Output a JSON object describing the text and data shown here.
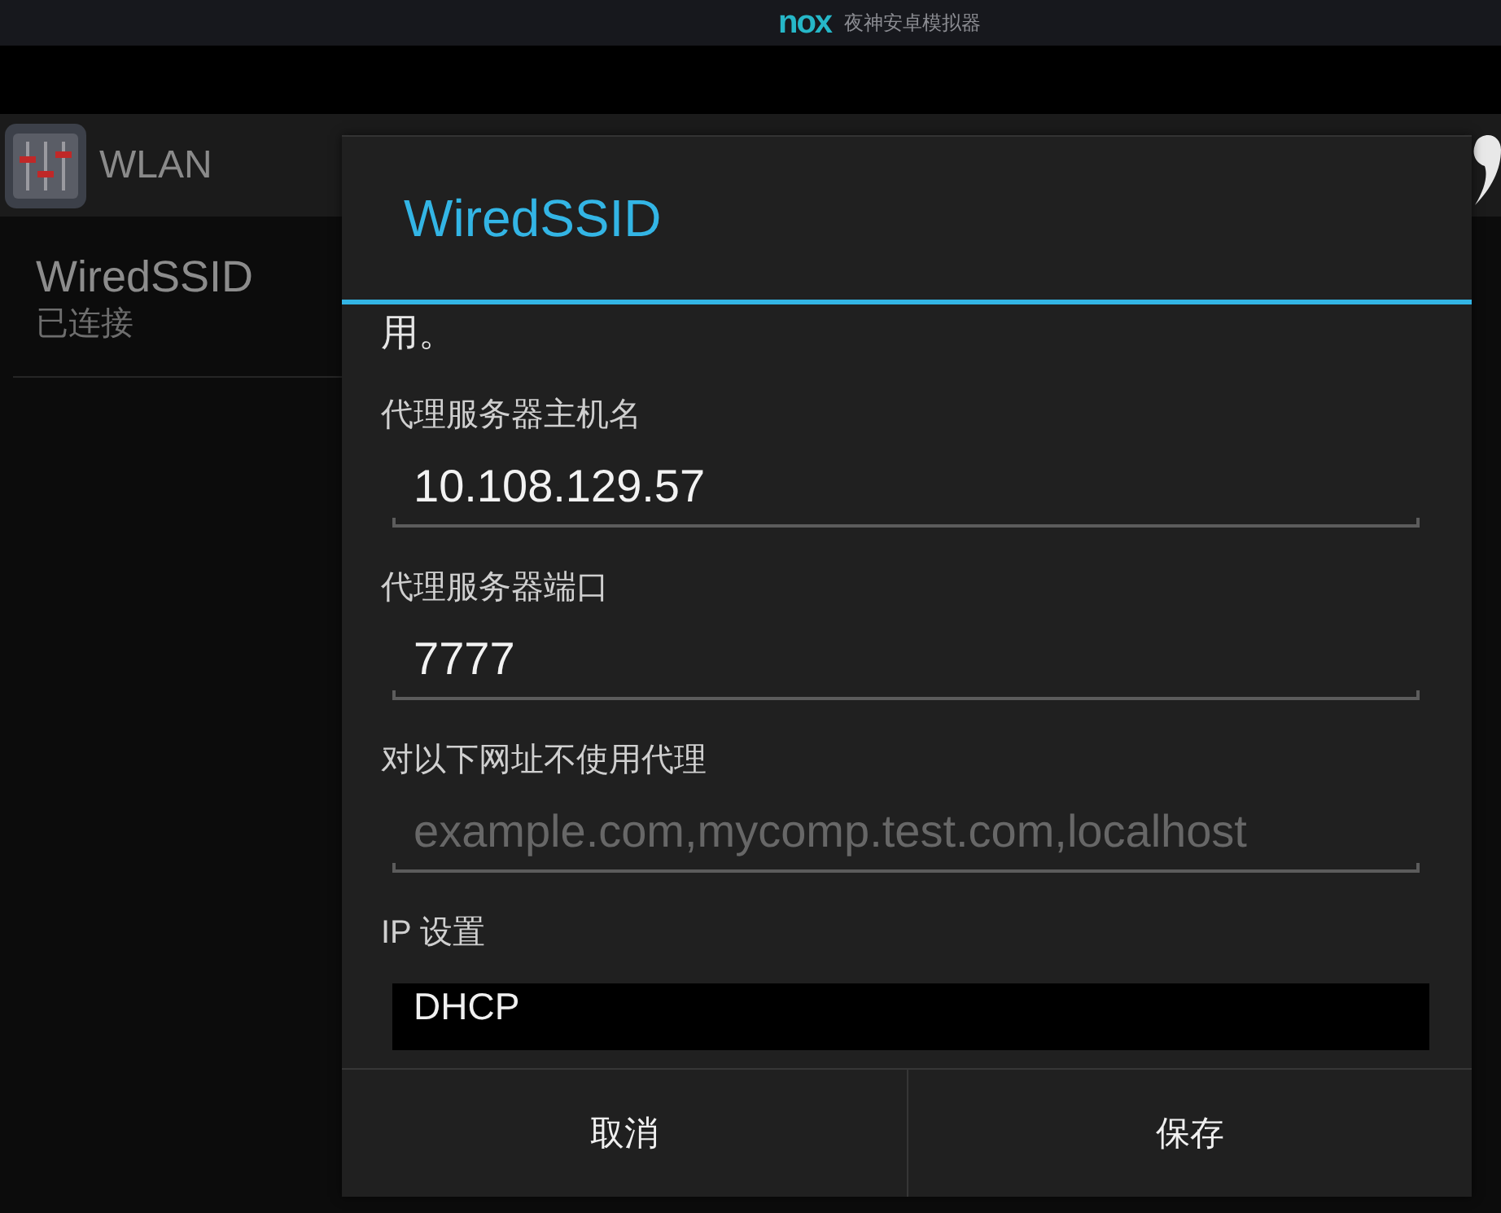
{
  "emulator_title_bar": {
    "logo": "nox",
    "app_name": "夜神安卓模拟器"
  },
  "action_bar": {
    "title": "WLAN"
  },
  "network_list": [
    {
      "name": "WiredSSID",
      "status": "已连接"
    }
  ],
  "dialog": {
    "title": "WiredSSID",
    "truncated_text": "用。",
    "fields": [
      {
        "kind": "text_input",
        "label": "代理服务器主机名",
        "value": "10.108.129.57"
      },
      {
        "kind": "text_input",
        "label": "代理服务器端口",
        "value": "7777"
      },
      {
        "kind": "text_input",
        "label": "对以下网址不使用代理",
        "placeholder": "example.com,mycomp.test.com,localhost"
      },
      {
        "kind": "dropdown",
        "label": "IP 设置",
        "value": "DHCP"
      }
    ],
    "buttons": [
      "取消",
      "保存"
    ]
  }
}
